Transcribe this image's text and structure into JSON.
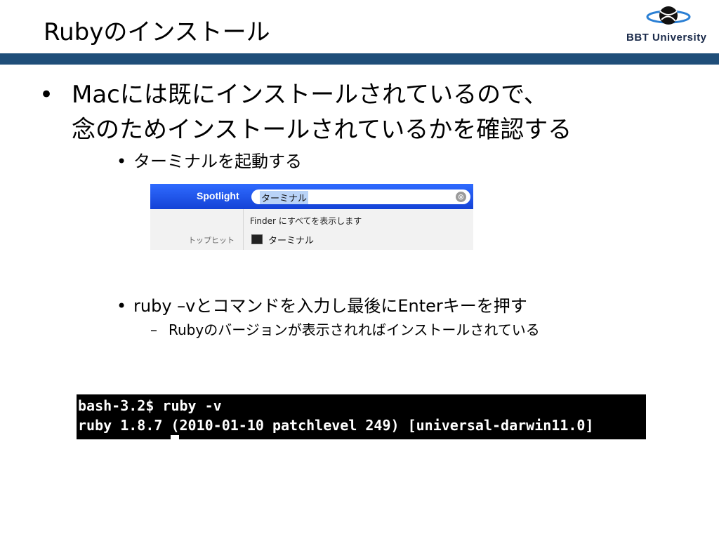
{
  "slide": {
    "title": "Rubyのインストール",
    "logo_text": "BBT University"
  },
  "bullets": {
    "main_line1": "Macには既にインストールされているので、",
    "main_line2": "念のためインストールされているかを確認する",
    "sub1": "ターミナルを起動する",
    "sub2": "ruby –vとコマンドを入力し最後にEnterキーを押す",
    "sub2_detail": "Rubyのバージョンが表示されればインストールされている",
    "bullet_symbol": "•",
    "dash_symbol": "–"
  },
  "spotlight": {
    "label": "Spotlight",
    "search_value": "ターミナル",
    "clear_glyph": "⊗",
    "finder_text": "Finder にすべてを表示します",
    "top_hit_label": "トップヒット",
    "result_label": "ターミナル",
    "accent_color": "#1f5cf0"
  },
  "terminal": {
    "line1": "bash-3.2$ ruby -v",
    "line2": "ruby 1.8.7 (2010-01-10 patchlevel 249) [universal-darwin11.0]"
  },
  "colors": {
    "title_bar": "#1f4e79"
  }
}
